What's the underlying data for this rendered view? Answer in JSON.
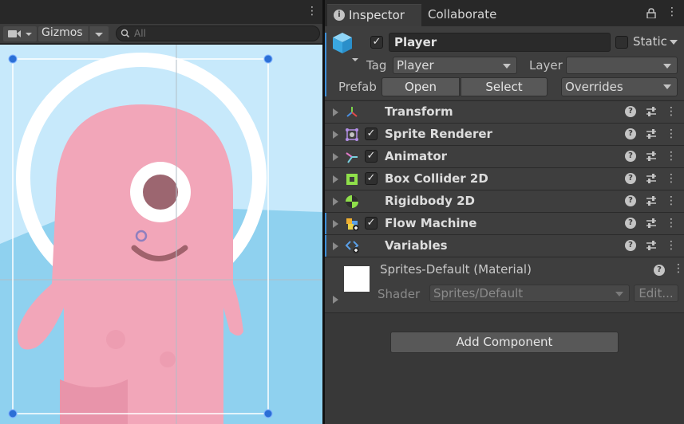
{
  "scene": {
    "gizmos_label": "Gizmos",
    "search_placeholder": "All"
  },
  "inspector": {
    "tabs": [
      {
        "label": "Inspector",
        "active": true
      },
      {
        "label": "Collaborate",
        "active": false
      }
    ],
    "object": {
      "enabled": true,
      "name": "Player",
      "static_label": "Static",
      "static_checked": false,
      "tag_label": "Tag",
      "tag_value": "Player",
      "layer_label": "Layer",
      "layer_value": "",
      "prefab_label": "Prefab",
      "prefab_open": "Open",
      "prefab_select": "Select",
      "prefab_overrides": "Overrides"
    },
    "components": [
      {
        "title": "Transform",
        "icon": "transform-icon",
        "has_checkbox": false,
        "checked": false
      },
      {
        "title": "Sprite Renderer",
        "icon": "sprite-renderer-icon",
        "has_checkbox": true,
        "checked": true
      },
      {
        "title": "Animator",
        "icon": "animator-icon",
        "has_checkbox": true,
        "checked": true
      },
      {
        "title": "Box Collider 2D",
        "icon": "box-collider-icon",
        "has_checkbox": true,
        "checked": true
      },
      {
        "title": "Rigidbody 2D",
        "icon": "rigidbody-icon",
        "has_checkbox": false,
        "checked": false
      },
      {
        "title": "Flow Machine",
        "icon": "flow-machine-icon",
        "has_checkbox": true,
        "checked": true
      },
      {
        "title": "Variables",
        "icon": "variables-icon",
        "has_checkbox": false,
        "checked": false
      }
    ],
    "material": {
      "name": "Sprites-Default (Material)",
      "shader_label": "Shader",
      "shader_value": "Sprites/Default",
      "edit_label": "Edit..."
    },
    "add_component_label": "Add Component"
  },
  "colors": {
    "accent": "#3d8fd8",
    "sky": "#c7e9fb",
    "character_pink": "#f0a4b8"
  }
}
